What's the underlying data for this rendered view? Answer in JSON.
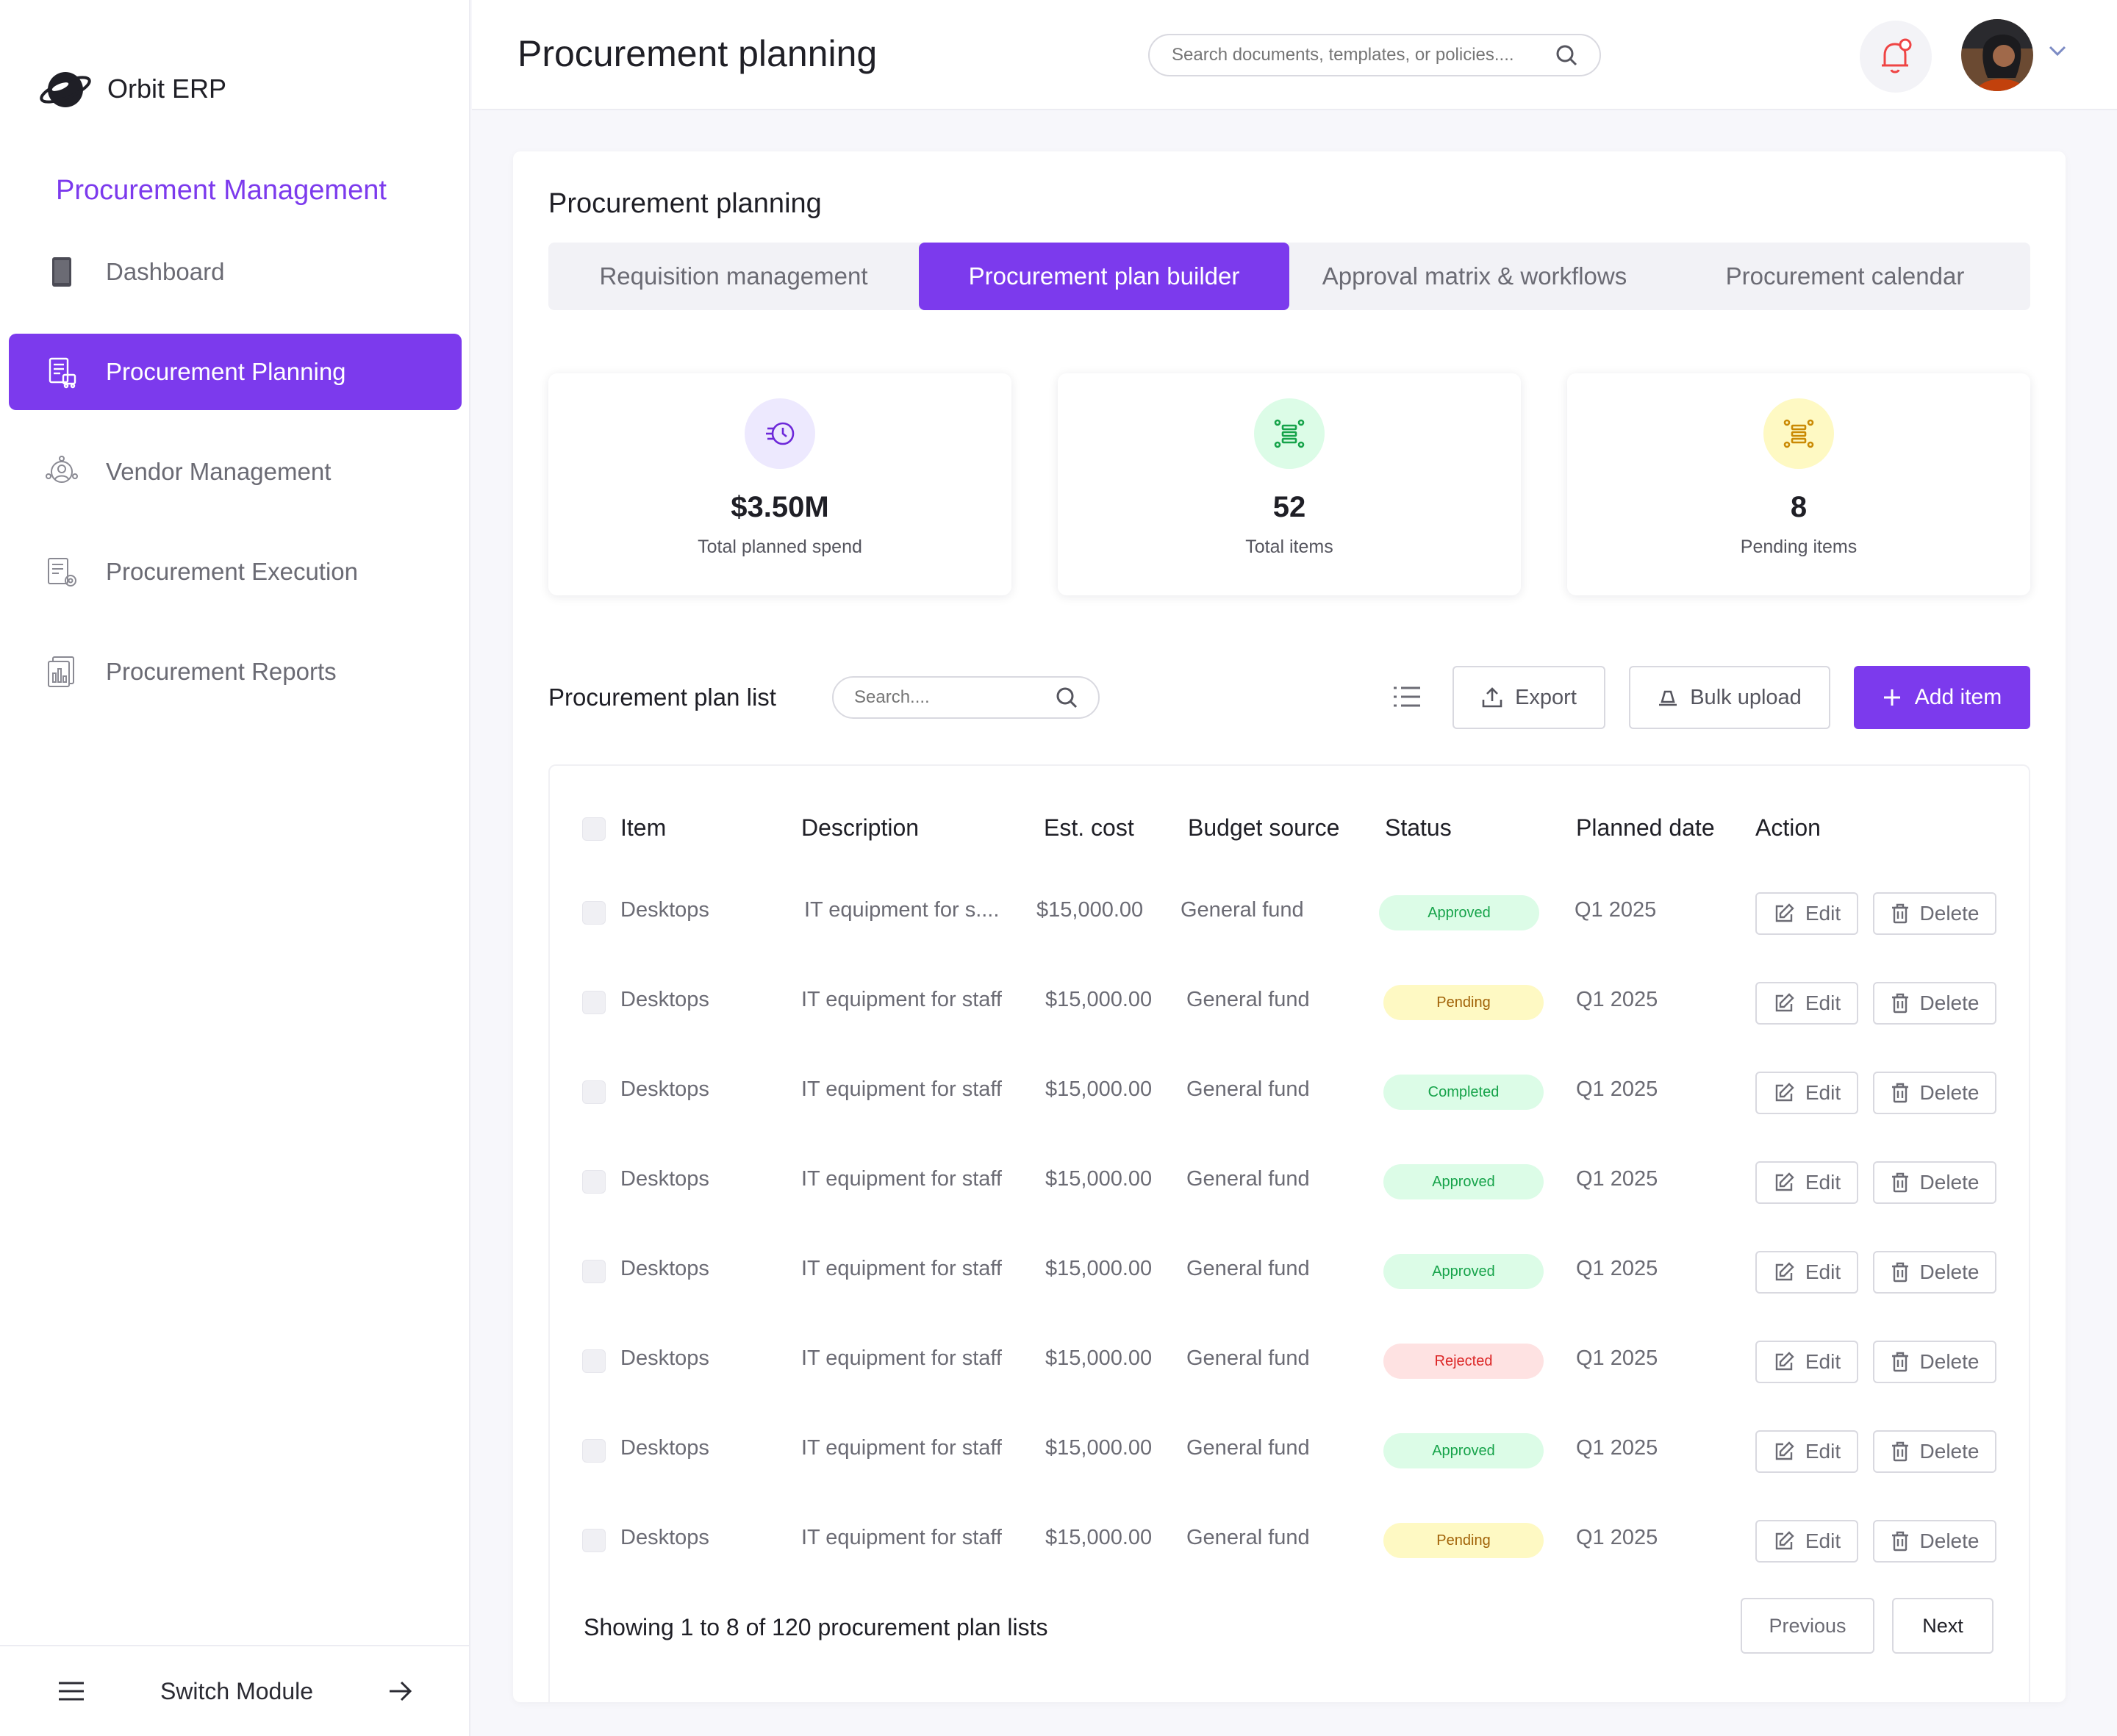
{
  "app": {
    "name": "Orbit ERP"
  },
  "sidebar": {
    "module_title": "Procurement Management",
    "items": [
      {
        "label": "Dashboard",
        "icon": "tablet-icon"
      },
      {
        "label": "Procurement Planning",
        "icon": "planning-icon",
        "active": true
      },
      {
        "label": "Vendor Management",
        "icon": "vendor-icon"
      },
      {
        "label": "Procurement Execution",
        "icon": "execution-icon"
      },
      {
        "label": "Procurement Reports",
        "icon": "reports-icon"
      }
    ],
    "footer": {
      "label": "Switch Module"
    }
  },
  "header": {
    "title": "Procurement planning",
    "search_placeholder": "Search documents, templates, or policies...."
  },
  "main": {
    "section_title": "Procurement planning",
    "tabs": [
      {
        "label": "Requisition management"
      },
      {
        "label": "Procurement plan builder",
        "active": true
      },
      {
        "label": "Approval matrix & workflows"
      },
      {
        "label": "Procurement calendar"
      }
    ],
    "stats": [
      {
        "value": "$3.50M",
        "label": "Total planned spend",
        "icon": "spend-icon"
      },
      {
        "value": "52",
        "label": "Total items",
        "icon": "items-icon"
      },
      {
        "value": "8",
        "label": "Pending items",
        "icon": "pending-icon"
      }
    ],
    "list": {
      "title": "Procurement plan list",
      "search_placeholder": "Search....",
      "export_label": "Export",
      "bulk_label": "Bulk upload",
      "add_label": "Add item"
    },
    "table": {
      "headers": {
        "item": "Item",
        "description": "Description",
        "cost": "Est. cost",
        "budget": "Budget source",
        "status": "Status",
        "date": "Planned date",
        "action": "Action"
      },
      "rows": [
        {
          "item": "Desktops",
          "description": "IT equipment for s....",
          "cost": "$15,000.00",
          "budget": "General fund",
          "status": "Approved",
          "date": "Q1 2025"
        },
        {
          "item": "Desktops",
          "description": "IT equipment for staff",
          "cost": "$15,000.00",
          "budget": "General fund",
          "status": "Pending",
          "date": "Q1 2025"
        },
        {
          "item": "Desktops",
          "description": "IT equipment for staff",
          "cost": "$15,000.00",
          "budget": "General fund",
          "status": "Completed",
          "date": "Q1 2025"
        },
        {
          "item": "Desktops",
          "description": "IT equipment for staff",
          "cost": "$15,000.00",
          "budget": "General fund",
          "status": "Approved",
          "date": "Q1 2025"
        },
        {
          "item": "Desktops",
          "description": "IT equipment for staff",
          "cost": "$15,000.00",
          "budget": "General fund",
          "status": "Approved",
          "date": "Q1 2025"
        },
        {
          "item": "Desktops",
          "description": "IT equipment for staff",
          "cost": "$15,000.00",
          "budget": "General fund",
          "status": "Rejected",
          "date": "Q1 2025"
        },
        {
          "item": "Desktops",
          "description": "IT equipment for staff",
          "cost": "$15,000.00",
          "budget": "General fund",
          "status": "Approved",
          "date": "Q1 2025"
        },
        {
          "item": "Desktops",
          "description": "IT equipment for staff",
          "cost": "$15,000.00",
          "budget": "General fund",
          "status": "Pending",
          "date": "Q1 2025"
        }
      ],
      "edit_label": "Edit",
      "delete_label": "Delete"
    },
    "pagination": {
      "summary": "Showing 1 to 8 of 120 procurement plan  lists",
      "previous": "Previous",
      "next": "Next"
    }
  },
  "colors": {
    "accent": "#7c3aed",
    "approved_bg": "#dcfce7",
    "approved_fg": "#16a34a",
    "pending_bg": "#fef9c3",
    "pending_fg": "#a16207",
    "completed_bg": "#dcfce7",
    "completed_fg": "#16a34a",
    "rejected_bg": "#fee2e2",
    "rejected_fg": "#dc2626"
  }
}
